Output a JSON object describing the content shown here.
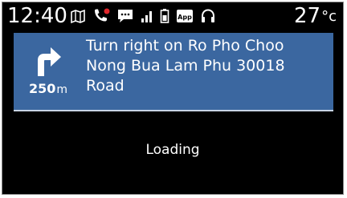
{
  "status_bar": {
    "time": "12:40",
    "temperature_value": "27",
    "temperature_unit": "°c",
    "icons": [
      "map-icon",
      "missed-call-icon",
      "message-icon",
      "signal-icon",
      "battery-icon",
      "app-icon",
      "headphones-icon"
    ],
    "app_badge_label": "App",
    "missed_call_color": "#e0262b"
  },
  "navigation": {
    "maneuver": "turn-right-arrow",
    "distance_value": "250",
    "distance_unit": "m",
    "instruction": "Turn right on Ro Pho Choo Nong Bua Lam Phu 30018 Road",
    "banner_color": "#3b67a0"
  },
  "main": {
    "status_text": "Loading"
  }
}
